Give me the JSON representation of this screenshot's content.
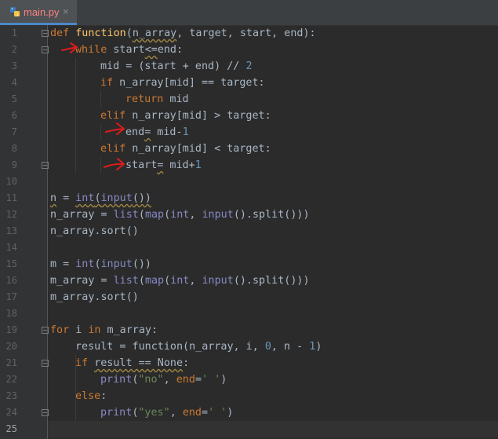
{
  "tab": {
    "filename": "main.py",
    "close_symbol": "×",
    "icon": "python-file-icon"
  },
  "colors": {
    "background": "#2b2b2b",
    "keyword": "#cc7832",
    "function": "#ffc66d",
    "builtin": "#8888c6",
    "number": "#6897bb",
    "string": "#6a8759",
    "text": "#a9b7c6",
    "annotation": "#e01b1b"
  },
  "editor": {
    "current_line": 25,
    "line_numbers": [
      "1",
      "2",
      "3",
      "4",
      "5",
      "6",
      "7",
      "8",
      "9",
      "10",
      "11",
      "12",
      "13",
      "14",
      "15",
      "16",
      "17",
      "18",
      "19",
      "20",
      "21",
      "22",
      "23",
      "24",
      "25"
    ],
    "code": {
      "l1": {
        "def": "def",
        "name": "function",
        "p1": "(",
        "arg": "n_array",
        "rest": ", target, start, end):"
      },
      "l2": {
        "kw": "while",
        "a": " start",
        "op": "<=",
        "b": "end:"
      },
      "l3": {
        "a": "mid = (start + end) // ",
        "num": "2"
      },
      "l4": {
        "kw": "if",
        "rest": " n_array[mid] == target:"
      },
      "l5": {
        "kw": "return",
        "rest": " mid"
      },
      "l6": {
        "kw": "elif",
        "rest": " n_array[mid] > target:"
      },
      "l7": {
        "a": "end",
        "op": "=",
        "b": " mid-",
        "num": "1"
      },
      "l8": {
        "kw": "elif",
        "rest": " n_array[mid] < target:"
      },
      "l9": {
        "a": "start",
        "op": "=",
        "b": " mid+",
        "num": "1"
      },
      "l11": {
        "a": "n",
        "b": " = ",
        "fn1": "int",
        "p1": "(",
        "fn2": "input",
        "p2": "())"
      },
      "l12": {
        "a": "n_array = ",
        "fn1": "list",
        "p1": "(",
        "fn2": "map",
        "p2": "(",
        "fn3": "int",
        "p3": ", ",
        "fn4": "input",
        "p4": "().split()))"
      },
      "l13": {
        "a": "n_array.sort()"
      },
      "l15": {
        "a": "m = ",
        "fn1": "int",
        "p1": "(",
        "fn2": "input",
        "p2": "())"
      },
      "l16": {
        "a": "m_array = ",
        "fn1": "list",
        "p1": "(",
        "fn2": "map",
        "p2": "(",
        "fn3": "int",
        "p3": ", ",
        "fn4": "input",
        "p4": "().split()))"
      },
      "l17": {
        "a": "m_array.sort()"
      },
      "l19": {
        "kw1": "for",
        "a": " i ",
        "kw2": "in",
        "b": " m_array:"
      },
      "l20": {
        "a": "result = function(n_array, i, ",
        "num1": "0",
        "b": ", n - ",
        "num2": "1",
        "c": ")"
      },
      "l21": {
        "kw": "if",
        "a": " ",
        "sq": "result == None",
        "b": ":"
      },
      "l22": {
        "fn": "print",
        "a": "(",
        "s1": "\"no\"",
        "b": ", ",
        "kw": "end",
        "c": "=",
        "s2": "' '",
        "d": ")"
      },
      "l23": {
        "kw": "else",
        "a": ":"
      },
      "l24": {
        "fn": "print",
        "a": "(",
        "s1": "\"yes\"",
        "b": ", ",
        "kw": "end",
        "c": "=",
        "s2": "' '",
        "d": ")"
      }
    }
  }
}
